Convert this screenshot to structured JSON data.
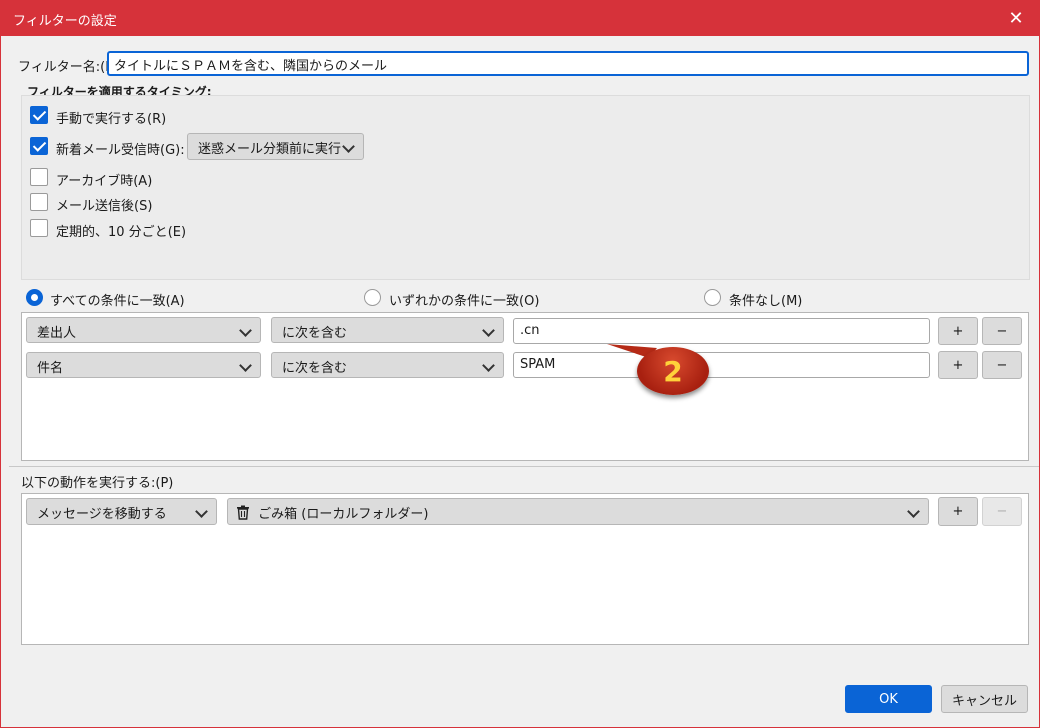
{
  "window": {
    "title": "フィルターの設定",
    "close_glyph": "✕"
  },
  "filter_name": {
    "label": "フィルター名:(I)",
    "value": "タイトルにＳＰＡＭを含む、隣国からのメール"
  },
  "timing": {
    "heading": "フィルターを適用するタイミング:",
    "manual": {
      "label": "手動で実行する",
      "key": "(R)",
      "checked": true
    },
    "new_mail": {
      "label": "新着メール受信時",
      "key": "(G):",
      "checked": true,
      "dropdown": "迷惑メール分類前に実行"
    },
    "archive": {
      "label": "アーカイブ時",
      "key": "(A)",
      "checked": false
    },
    "after_send": {
      "label": "メール送信後",
      "key": "(S)",
      "checked": false
    },
    "periodic": {
      "label": "定期的、10 分ごと",
      "key": "(E)",
      "checked": false
    }
  },
  "match": {
    "all": {
      "label": "すべての条件に一致",
      "key": "(A)",
      "selected": true
    },
    "any": {
      "label": "いずれかの条件に一致",
      "key": "(O)",
      "selected": false
    },
    "none": {
      "label": "条件なし",
      "key": "(M)",
      "selected": false
    }
  },
  "conditions": [
    {
      "field": "差出人",
      "operator": "に次を含む",
      "value": ".cn",
      "add": "+",
      "remove": "−"
    },
    {
      "field": "件名",
      "operator": "に次を含む",
      "value": "SPAM",
      "add": "+",
      "remove": "−"
    }
  ],
  "callout": {
    "number": "2",
    "color": "#c0321a"
  },
  "actions": {
    "heading": "以下の動作を実行する:(P)",
    "action": "メッセージを移動する",
    "target": "ごみ箱 (ローカルフォルダー)",
    "target_icon": "trash-icon",
    "add": "+",
    "remove": "−"
  },
  "buttons": {
    "ok": "OK",
    "cancel": "キャンセル"
  },
  "colors": {
    "accent": "#0a64d6",
    "titlebar": "#d6323a"
  }
}
